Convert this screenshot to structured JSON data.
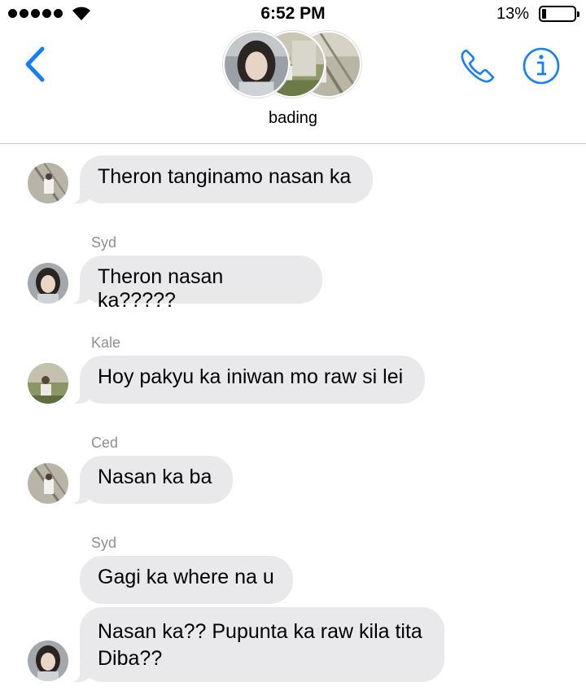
{
  "status_bar": {
    "time": "6:52 PM",
    "battery_percent": "13%",
    "signal_bars": 5,
    "battery_level": 0.13
  },
  "header": {
    "group_name": "bading",
    "back_icon": "chevron-left-icon",
    "call_icon": "phone-icon",
    "info_icon": "info-icon",
    "accent_color": "#147efb"
  },
  "messages": [
    {
      "sender": "",
      "text": "Theron tanginamo nasan ka"
    },
    {
      "sender": "Syd",
      "text": "Theron nasan ka?????"
    },
    {
      "sender": "Kale",
      "text": "Hoy pakyu ka iniwan mo raw si lei"
    },
    {
      "sender": "Ced",
      "text": "Nasan ka ba"
    },
    {
      "sender": "Syd",
      "text": "Gagi ka where na u"
    },
    {
      "sender": "",
      "text": "Nasan ka?? Pupunta ka raw kila tita Diba??"
    }
  ],
  "colors": {
    "bubble_background": "#e9e9eb",
    "sender_label": "#8e8e93",
    "divider": "#c8c8cc"
  }
}
